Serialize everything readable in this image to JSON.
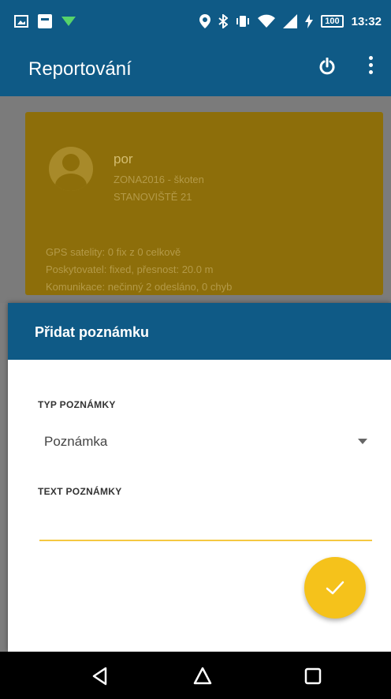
{
  "status_bar": {
    "battery": "100",
    "time": "13:32"
  },
  "app_bar": {
    "title": "Reportování"
  },
  "card": {
    "name": "por",
    "line1": "ZONA2016 - škoten",
    "line2": "STANOVIŠTĚ 21",
    "gps": "GPS satelity: 0 fix z 0 celkově",
    "provider": "Poskytovatel: fixed, přesnost: 20.0 m",
    "communication": "Komunikace: nečinný 2 odesláno, 0 chyb"
  },
  "dialog": {
    "title": "Přidat poznámku",
    "type_label": "TYP POZNÁMKY",
    "type_value": "Poznámka",
    "text_label": "TEXT POZNÁMKY",
    "text_value": ""
  },
  "colors": {
    "primary": "#0f5a86",
    "accent": "#f5c21b",
    "card": "#8d6e0a"
  },
  "icons": {
    "power": "power-icon",
    "more": "more-vert-icon",
    "confirm": "check-icon",
    "back": "back-icon",
    "home": "home-icon",
    "recents": "recents-icon"
  }
}
